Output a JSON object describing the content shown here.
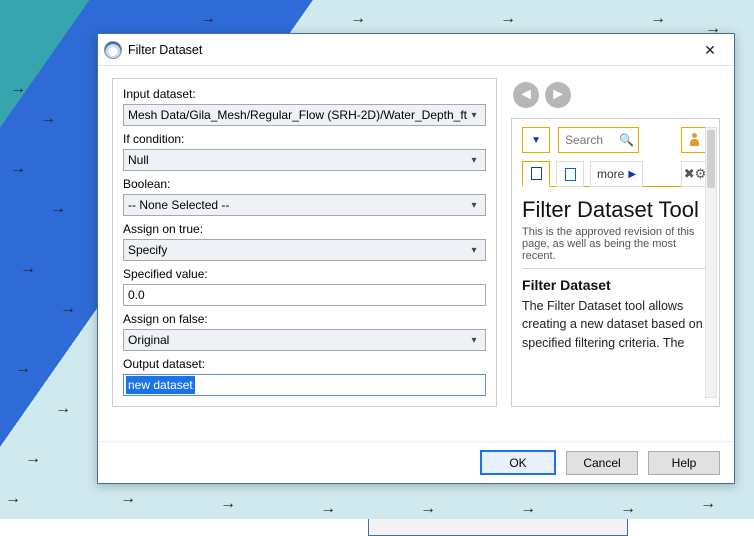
{
  "window": {
    "title": "Filter Dataset"
  },
  "form": {
    "label_input_dataset": "Input dataset:",
    "input_dataset": "Mesh Data/Gila_Mesh/Regular_Flow (SRH-2D)/Water_Depth_ft",
    "label_if_condition": "If condition:",
    "if_condition": "Null",
    "label_boolean": "Boolean:",
    "boolean": "-- None Selected --",
    "label_assign_true": "Assign on true:",
    "assign_true": "Specify",
    "label_specified_value": "Specified value:",
    "specified_value": "0.0",
    "label_assign_false": "Assign on false:",
    "assign_false": "Original",
    "label_output_dataset": "Output dataset:",
    "output_dataset": "new dataset"
  },
  "toolbar": {
    "search_placeholder": "Search",
    "more_label": "more"
  },
  "help": {
    "title": "Filter Dataset Tool",
    "revision": "This is the approved revision of this page, as well as being the most recent.",
    "section_heading": "Filter Dataset",
    "body": "The Filter Dataset tool allows creating a new dataset based on specified filtering criteria. The"
  },
  "buttons": {
    "ok": "OK",
    "cancel": "Cancel",
    "help": "Help"
  }
}
